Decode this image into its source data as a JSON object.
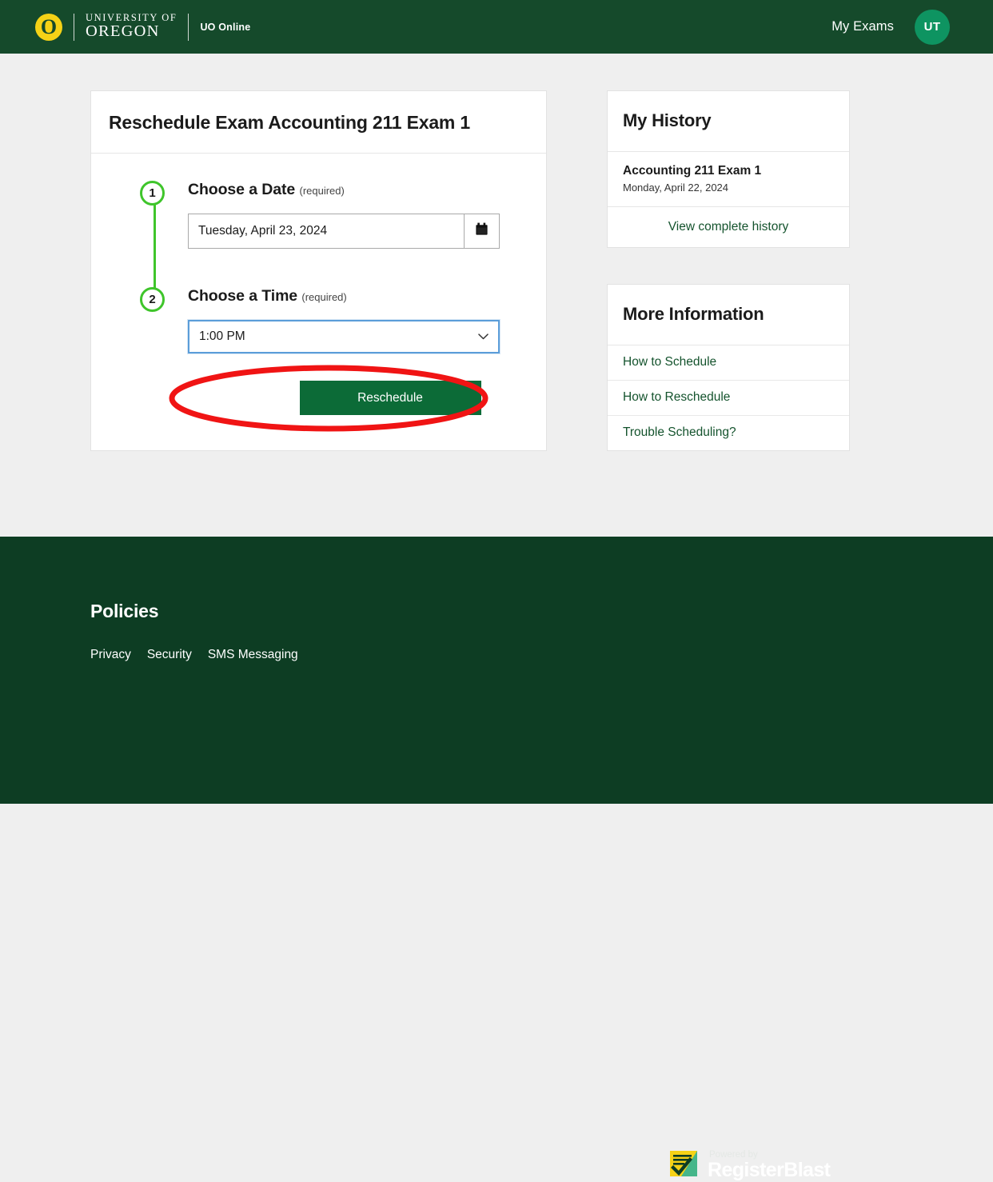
{
  "header": {
    "logo_letter": "O",
    "university_line1": "UNIVERSITY OF",
    "university_line2": "OREGON",
    "sub_brand": "UO Online",
    "nav_link": "My Exams",
    "avatar_initials": "UT",
    "bar_color": "#154a2b",
    "avatar_color": "#0e9461"
  },
  "main": {
    "title": "Reschedule Exam Accounting 211 Exam 1",
    "steps": [
      {
        "number": "1",
        "label": "Choose a Date",
        "required_note": "(required)",
        "field_value": "Tuesday, April 23, 2024",
        "field_icon": "calendar-icon"
      },
      {
        "number": "2",
        "label": "Choose a Time",
        "required_note": "(required)",
        "field_value": "1:00 PM",
        "field_icon": "chevron-down-icon"
      }
    ],
    "submit_label": "Reschedule",
    "submit_color": "#0c6b37",
    "annotation_color": "#f01414",
    "step_accent_color": "#3fc52b"
  },
  "sidebar": {
    "history": {
      "title": "My History",
      "items": [
        {
          "name": "Accounting 211 Exam 1",
          "date": "Monday, April 22, 2024"
        }
      ],
      "footer_link": "View complete history"
    },
    "more_information": {
      "title": "More Information",
      "links": [
        "How to Schedule",
        "How to Reschedule",
        "Trouble Scheduling?"
      ]
    },
    "link_color": "#14532d"
  },
  "footer": {
    "heading": "Policies",
    "links": [
      "Privacy",
      "Security",
      "SMS Messaging"
    ],
    "powered_by": "Powered by",
    "brand": "RegisterBlast",
    "background": "#0d3d23"
  }
}
